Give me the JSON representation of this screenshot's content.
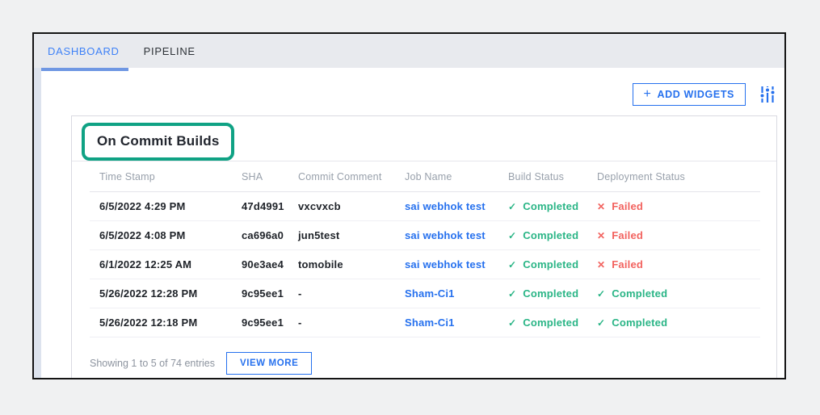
{
  "tabs": [
    {
      "label": "DASHBOARD",
      "active": true
    },
    {
      "label": "PIPELINE",
      "active": false
    }
  ],
  "toolbar": {
    "plus": "+",
    "add_widgets_label": "ADD WIDGETS",
    "sliders_icon": "sliders-icon"
  },
  "card": {
    "title": "On Commit Builds",
    "table": {
      "columns": [
        "Time Stamp",
        "SHA",
        "Commit Comment",
        "Job Name",
        "Build Status",
        "Deployment Status"
      ],
      "rows": [
        {
          "time": "6/5/2022 4:29 PM",
          "sha": "47d4991",
          "comment": "vxcvxcb",
          "job": "sai webhok test",
          "build": "Completed",
          "deploy": "Failed"
        },
        {
          "time": "6/5/2022 4:08 PM",
          "sha": "ca696a0",
          "comment": "jun5test",
          "job": "sai webhok test",
          "build": "Completed",
          "deploy": "Failed"
        },
        {
          "time": "6/1/2022 12:25 AM",
          "sha": "90e3ae4",
          "comment": "tomobile",
          "job": "sai webhok test",
          "build": "Completed",
          "deploy": "Failed"
        },
        {
          "time": "5/26/2022 12:28 PM",
          "sha": "9c95ee1",
          "comment": "-",
          "job": "Sham-Ci1",
          "build": "Completed",
          "deploy": "Completed"
        },
        {
          "time": "5/26/2022 12:18 PM",
          "sha": "9c95ee1",
          "comment": "-",
          "job": "Sham-Ci1",
          "build": "Completed",
          "deploy": "Completed"
        }
      ]
    },
    "footer": {
      "showing_text": "Showing 1 to 5 of 74 entries",
      "view_more_label": "VIEW MORE"
    }
  },
  "icons": {
    "check": "✓",
    "cross": "✕"
  },
  "colors": {
    "accent_blue": "#2570ee",
    "success_green": "#2ab586",
    "error_red": "#f2625e",
    "annotation_green": "#0fa284"
  }
}
